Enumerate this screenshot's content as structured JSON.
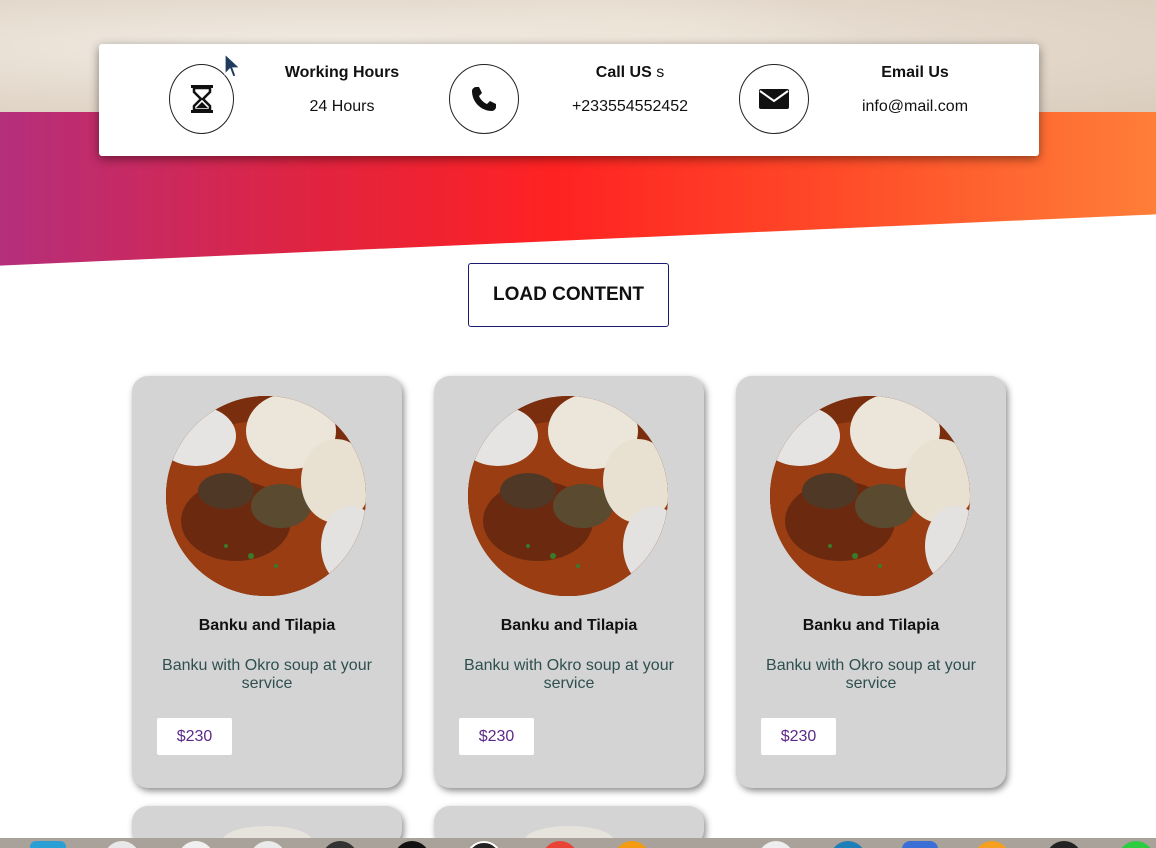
{
  "info_bar": {
    "working_hours": {
      "title": "Working Hours",
      "value": "24 Hours",
      "icon": "hourglass-icon"
    },
    "call": {
      "title": "Call US",
      "title_suffix": "s",
      "value": "+233554552452",
      "icon": "phone-icon"
    },
    "email": {
      "title": "Email Us",
      "value": "info@mail.com",
      "icon": "envelope-icon"
    }
  },
  "load_button": {
    "label": "LOAD CONTENT"
  },
  "cards": [
    {
      "title": "Banku and Tilapia",
      "description": "Banku with Okro soup at your service",
      "price": "$230"
    },
    {
      "title": "Banku and Tilapia",
      "description": "Banku with Okro soup at your service",
      "price": "$230"
    },
    {
      "title": "Banku and Tilapia",
      "description": "Banku with Okro soup at your service",
      "price": "$230"
    }
  ],
  "colors": {
    "gradient": [
      "#b42f7c",
      "#ff2222",
      "#ff7e38"
    ],
    "card_bg": "#d4d4d4",
    "price_text": "#5b2a86",
    "button_border": "#1a1a6e"
  }
}
